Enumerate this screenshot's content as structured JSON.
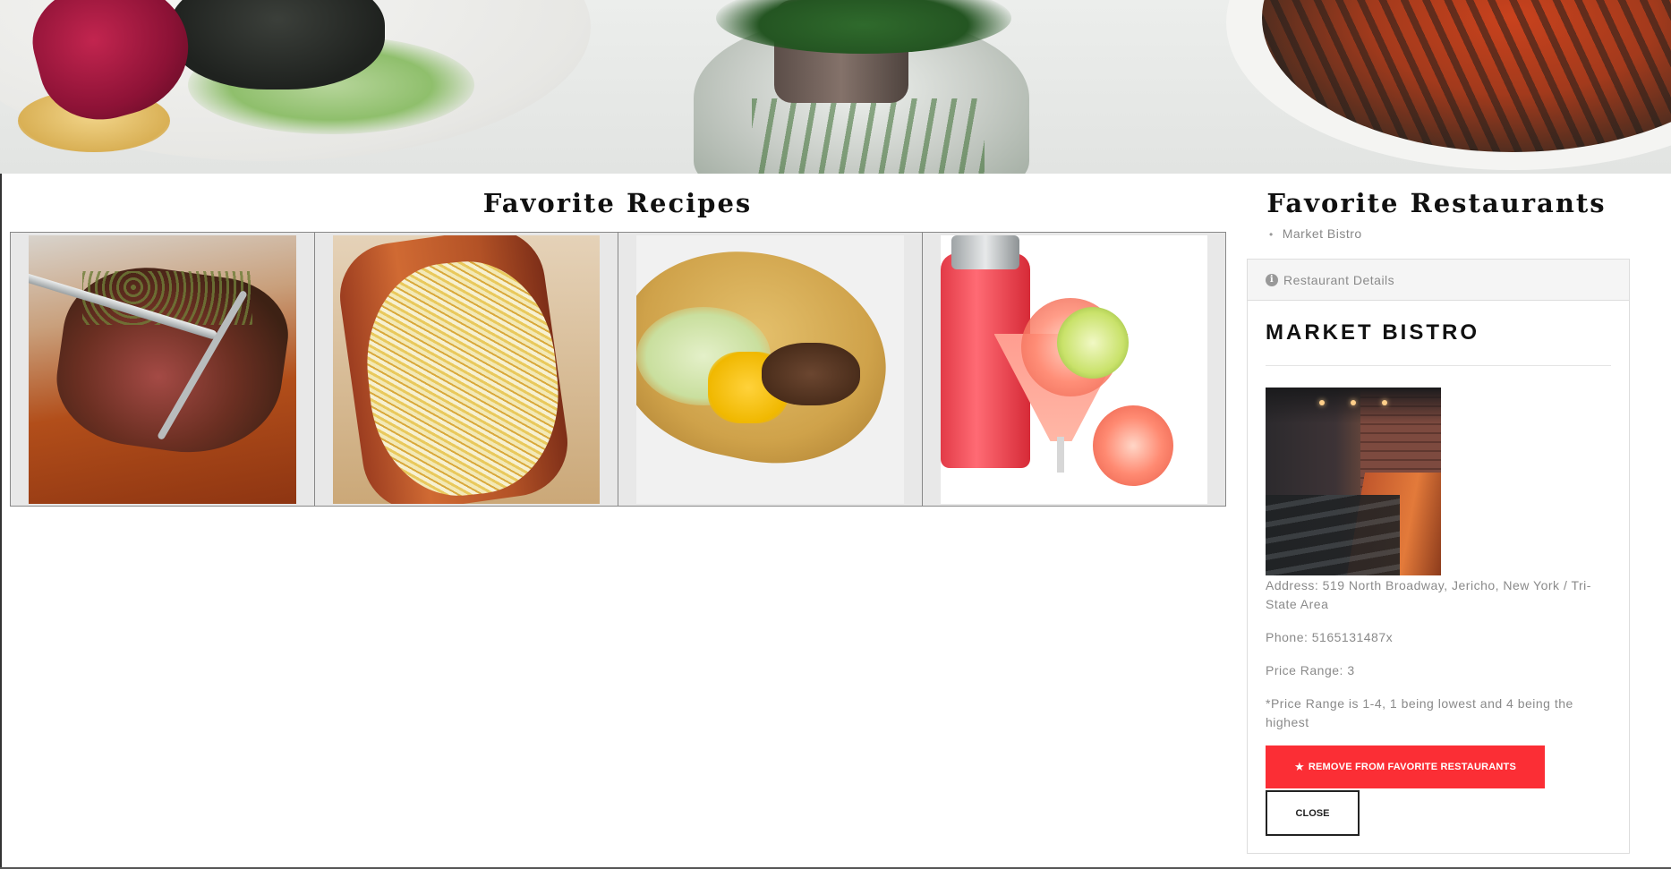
{
  "recipes": {
    "title": "Favorite Recipes",
    "items": [
      {
        "name": "steak",
        "image": "sliced-steak-photo"
      },
      {
        "name": "hotdog",
        "image": "sauerkraut-hotdog-photo"
      },
      {
        "name": "taco",
        "image": "taco-photo"
      },
      {
        "name": "drink",
        "image": "grapefruit-cocktail-photo"
      }
    ]
  },
  "restaurants": {
    "title": "Favorite Restaurants",
    "list": [
      "Market Bistro"
    ],
    "details": {
      "heading": "Restaurant Details",
      "heading_icon": "info-circle-icon",
      "name": "MARKET BISTRO",
      "photo": "restaurant-interior-photo",
      "address": "Address: 519 North Broadway, Jericho, New York / Tri-State Area",
      "phone": "Phone: 5165131487x",
      "price_range": "Price Range: 3",
      "price_note": "*Price Range is 1-4, 1 being lowest and 4 being the highest",
      "remove_label": "REMOVE FROM FAVORITE RESTAURANTS",
      "remove_icon": "star-icon",
      "close_label": "CLOSE"
    }
  },
  "colors": {
    "accent_red": "#fb2e35",
    "text_muted": "#8a8a8a",
    "heading": "#111111"
  }
}
